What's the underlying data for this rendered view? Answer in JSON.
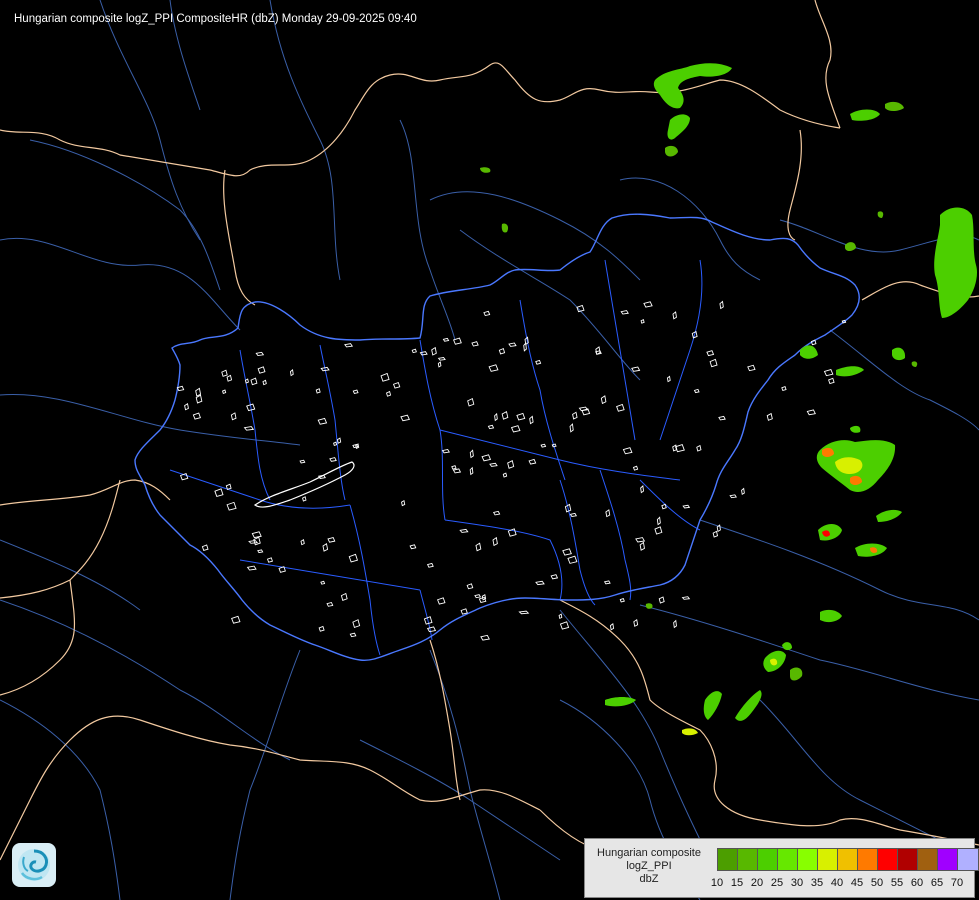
{
  "header": {
    "title": "Hungarian composite logZ_PPI CompositeHR (dbZ) Monday 29-09-2025 09:40"
  },
  "colors": {
    "background": "#000000",
    "country_border": "#f2c9a0",
    "hungary_border": "#4a78ff",
    "county_border": "#2a5cff",
    "rivers": "#3a5fa8",
    "lakes": "#ffffff"
  },
  "legend": {
    "label_lines": [
      "Hungarian composite",
      "logZ_PPI",
      "dbZ"
    ],
    "steps": [
      {
        "value": "10",
        "color": "#4c9e00"
      },
      {
        "value": "15",
        "color": "#58b800"
      },
      {
        "value": "20",
        "color": "#4ccf00"
      },
      {
        "value": "25",
        "color": "#66e800"
      },
      {
        "value": "30",
        "color": "#88ff00"
      },
      {
        "value": "35",
        "color": "#d8f000"
      },
      {
        "value": "40",
        "color": "#f0c000"
      },
      {
        "value": "45",
        "color": "#ff7a00"
      },
      {
        "value": "50",
        "color": "#ff0000"
      },
      {
        "value": "55",
        "color": "#b00000"
      },
      {
        "value": "60",
        "color": "#a06010"
      },
      {
        "value": "65",
        "color": "#a000ff"
      },
      {
        "value": "70",
        "color": "#b0b0ff"
      }
    ],
    "end_tick": ""
  },
  "logo": {
    "icon": "met-service-swirl-icon"
  }
}
